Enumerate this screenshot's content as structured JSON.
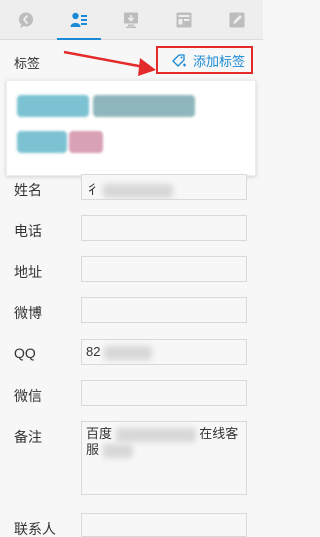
{
  "tabs": [
    {
      "icon": "chat-bubble-icon",
      "active": false
    },
    {
      "icon": "contact-card-icon",
      "active": true
    },
    {
      "icon": "monitor-download-icon",
      "active": false
    },
    {
      "icon": "form-icon",
      "active": false
    },
    {
      "icon": "edit-icon",
      "active": false
    }
  ],
  "tag_section": {
    "label": "标签",
    "add_button": "添加标签"
  },
  "accent_color": "#1a8ad6",
  "highlight_color": "#e32b2b",
  "form": {
    "name": {
      "label": "姓名",
      "value": "彳"
    },
    "phone": {
      "label": "电话",
      "value": ""
    },
    "address": {
      "label": "地址",
      "value": ""
    },
    "weibo": {
      "label": "微博",
      "value": ""
    },
    "qq": {
      "label": "QQ",
      "value": "82"
    },
    "wechat": {
      "label": "微信",
      "value": ""
    },
    "note": {
      "label": "备注",
      "value_line1_start": "百度",
      "value_line1_end": "在线客",
      "value_line2": "服"
    },
    "contact": {
      "label": "联系人",
      "value": ""
    }
  }
}
